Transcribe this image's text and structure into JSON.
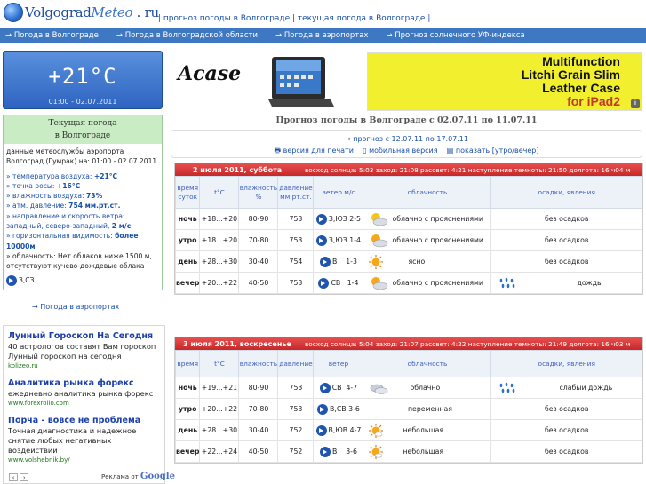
{
  "header": {
    "logo_part1": "Volgograd",
    "logo_part2": "Meteo",
    "logo_part3": " . ru",
    "links_text": "| прогноз погоды в Волгограде | текущая погода в Волгограде |"
  },
  "nav": {
    "items": [
      "→ Погода в Волгограде",
      "→ Погода в Волгоградской области",
      "→ Погода в аэропортах",
      "→ Прогноз солнечного УФ-индекса"
    ]
  },
  "current": {
    "temp": "+21°C",
    "datetime": "01:00 - 02.07.2011",
    "title_line1": "Текущая погода",
    "title_line2": "в Волгограде",
    "source": "данные метеослужбы аэропорта Волгоград (Гумрак) на: 01:00 - 02.07.2011",
    "air_temp_label": "» температура воздуха: ",
    "air_temp": "+21°C",
    "dew_label": "» точка росы: ",
    "dew": "+16°C",
    "humidity_label": "» влажность воздуха: ",
    "humidity": "73%",
    "pressure_label": "» атм. давление: ",
    "pressure": "754 мм.рт.ст.",
    "wind_label": "» направление и скорость ветра: западный, северо-западный, ",
    "wind_speed": "2 м/с",
    "visibility_label": "» горизонтальная видимость: ",
    "visibility": "более 10000м",
    "clouds": "» облачность: Нет облаков ниже 1500 м, отсутствуют кучево-дождевые облака",
    "wind_dir_short": "З,СЗ",
    "airports_link": "→ Погода в аэропортах"
  },
  "ads": {
    "items": [
      {
        "title": "Лунный Гороскоп На Сегодня",
        "text": "40 астрологов составят Вам гороскоп Лунный гороскоп на сегодня",
        "url": "kolizeo.ru"
      },
      {
        "title": "Аналитика рынка форекс",
        "text": "ежедневно аналитика рынка форекс",
        "url": "www.forexrollo.com"
      },
      {
        "title": "Порча - вовсе не проблема",
        "text": "Точная диагностика и надежное снятие любых негативных воздействий",
        "url": "www.volshebnik.by/"
      }
    ],
    "footer_label": "Реклама от ",
    "footer_brand": "Google"
  },
  "banner": {
    "acase": "Acase",
    "line1": "Multifunction",
    "line2": "Litchi Grain Slim",
    "line3": "Leather Case",
    "line4": "for iPad2",
    "info": "i"
  },
  "forecast": {
    "title": "Прогноз погоды в Волгограде с 02.07.11 по 11.07.11",
    "next_link": "→ прогноз с 12.07.11 по 17.07.11",
    "print": "версия для печати",
    "mobile": "мобильная версия",
    "show": "показать [утро/вечер]",
    "headers": [
      "время суток",
      "t°C",
      "влажность %",
      "давление мм.рт.ст.",
      "ветер м/с",
      "облачность",
      "осадки, явления"
    ],
    "headers2": [
      "время",
      "t°C",
      "влажность",
      "давление",
      "ветер",
      "облачность",
      "осадки, явления"
    ],
    "days": [
      {
        "date": "2 июля 2011, суббота",
        "sun": "восход солнца: 5:03   заход: 21:08   рассвет: 4:21   наступление темноты: 21:50   долгота: 16 ч04 м",
        "rows": [
          {
            "part": "ночь",
            "t": "+18...+20",
            "hum": "80-90",
            "pres": "753",
            "dir": "З,ЮЗ",
            "speed": "2-5",
            "cloud": "облачно с прояснениями",
            "cloud_icon": "partly-cloudy-night-icon",
            "precip": "без осадков"
          },
          {
            "part": "утро",
            "t": "+18...+20",
            "hum": "70-80",
            "pres": "753",
            "dir": "З,ЮЗ",
            "speed": "1-4",
            "cloud": "облачно с прояснениями",
            "cloud_icon": "partly-cloudy-icon",
            "precip": "без осадков"
          },
          {
            "part": "день",
            "t": "+28...+30",
            "hum": "30-40",
            "pres": "754",
            "dir": "В",
            "speed": "1-3",
            "cloud": "ясно",
            "cloud_icon": "sun-icon",
            "precip": "без осадков"
          },
          {
            "part": "вечер",
            "t": "+20...+22",
            "hum": "40-50",
            "pres": "753",
            "dir": "СВ",
            "speed": "1-4",
            "cloud": "облачно с прояснениями",
            "cloud_icon": "partly-cloudy-icon",
            "precip": "дождь"
          }
        ]
      },
      {
        "date": "3 июля 2011, воскресенье",
        "sun": "восход солнца: 5:04   заход: 21:07   рассвет: 4:22   наступление темноты: 21:49   долгота: 16 ч03 м",
        "rows": [
          {
            "part": "ночь",
            "t": "+19...+21",
            "hum": "80-90",
            "pres": "753",
            "dir": "СВ",
            "speed": "4-7",
            "cloud": "облачно",
            "cloud_icon": "cloudy-night-icon",
            "precip": "слабый дождь"
          },
          {
            "part": "утро",
            "t": "+20...+22",
            "hum": "70-80",
            "pres": "753",
            "dir": "В,СВ",
            "speed": "3-6",
            "cloud": "переменная",
            "cloud_icon": "partly-cloudy-icon",
            "precip": "без осадков"
          },
          {
            "part": "день",
            "t": "+28...+30",
            "hum": "30-40",
            "pres": "752",
            "dir": "В,ЮВ",
            "speed": "4-7",
            "cloud": "небольшая",
            "cloud_icon": "sun-cloud-icon",
            "precip": "без осадков"
          },
          {
            "part": "вечер",
            "t": "+22...+24",
            "hum": "40-50",
            "pres": "752",
            "dir": "В",
            "speed": "3-6",
            "cloud": "небольшая",
            "cloud_icon": "sun-cloud-icon",
            "precip": "без осадков"
          }
        ]
      }
    ]
  }
}
